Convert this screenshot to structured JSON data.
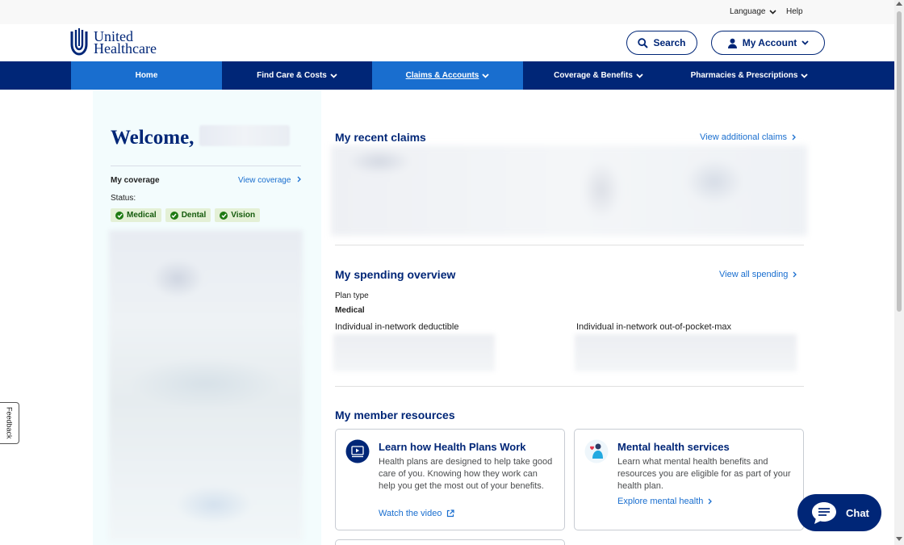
{
  "utility": {
    "language": "Language",
    "help": "Help"
  },
  "header": {
    "logo_line1": "United",
    "logo_line2": "Healthcare",
    "search_label": "Search",
    "account_label": "My Account"
  },
  "nav": {
    "items": [
      {
        "label": "Home"
      },
      {
        "label": "Find Care & Costs"
      },
      {
        "label": "Claims & Accounts"
      },
      {
        "label": "Coverage & Benefits"
      },
      {
        "label": "Pharmacies & Prescriptions"
      }
    ]
  },
  "left": {
    "welcome": "Welcome,",
    "my_coverage": "My coverage",
    "view_coverage": "View coverage",
    "status_label": "Status:",
    "chips": [
      {
        "label": "Medical"
      },
      {
        "label": "Dental"
      },
      {
        "label": "Vision"
      }
    ]
  },
  "claims": {
    "title": "My recent claims",
    "link": "View additional claims"
  },
  "spending": {
    "title": "My spending overview",
    "link": "View all spending",
    "plan_type_label": "Plan type",
    "plan_type_value": "Medical",
    "deductible_label": "Individual in-network deductible",
    "oop_label": "Individual in-network out-of-pocket-max"
  },
  "resources": {
    "title": "My member resources",
    "cards": [
      {
        "title": "Learn how Health Plans Work",
        "body": "Health plans are designed to help take good care of you. Knowing how they work can help you get the most out of your benefits.",
        "link": "Watch the video"
      },
      {
        "title": "Mental health services",
        "body": "Learn what mental health benefits and resources you are eligible for as part of your health plan.",
        "link": "Explore mental health"
      }
    ]
  },
  "feedback": "Feedback",
  "chat": "Chat",
  "colors": {
    "brand_navy": "#002677",
    "brand_blue": "#196ecf",
    "chip_green": "#e4f0d6"
  }
}
